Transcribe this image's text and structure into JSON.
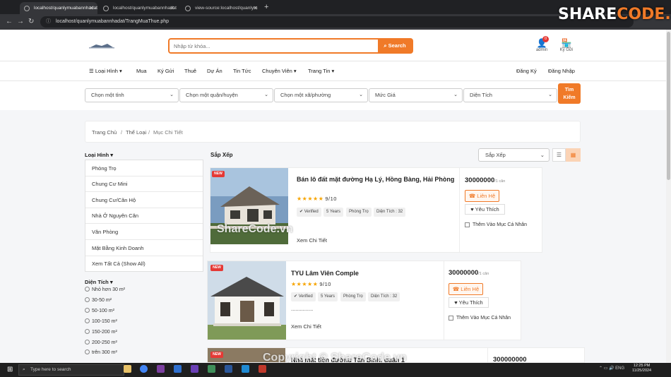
{
  "browser": {
    "tabs": [
      {
        "title": "localhost/quanlymuabannhadat"
      },
      {
        "title": "localhost/quanlymuabannhadat"
      },
      {
        "title": "view-source:localhost/quanlym"
      }
    ],
    "url": "localhost/quanlymuabannhadat/TrangMuaThue.php"
  },
  "brand_logo": {
    "part1": "SHARE",
    "part2": "CODE.vn"
  },
  "header": {
    "search_placeholder": "Nhập từ khóa...",
    "search_button": "Search",
    "user_label": "admin",
    "user_badge": "0",
    "deposit_label": "Ký Gửi"
  },
  "nav": {
    "items": [
      "Loại Hình",
      "Mua",
      "Ký Gửi",
      "Thuê",
      "Dự Án",
      "Tin Tức",
      "Chuyên Viên",
      "Trang Tin"
    ],
    "register": "Đăng Ký",
    "login": "Đăng Nhập"
  },
  "filter": {
    "province": "Chọn một tỉnh",
    "district": "Chọn một quận/huyện",
    "ward": "Chọn một xã/phường",
    "price": "Mức Giá",
    "area": "Diện Tích",
    "find_line1": "Tìm",
    "find_line2": "Kiếm"
  },
  "breadcrumb": [
    "Trang Chủ",
    "Thể Loại",
    "Mục Chi Tiết"
  ],
  "sidebar": {
    "type_heading": "Loại Hình",
    "categories": [
      "Phòng Trọ",
      "Chung Cư Mini",
      "Chung Cư/Căn Hộ",
      "Nhà Ở Nguyên Căn",
      "Văn Phòng",
      "Mặt Bằng Kinh Doanh",
      "Xem Tất Cả (Show All)"
    ],
    "area_heading": "Diện Tích",
    "areas": [
      "Nhỏ hơn 30 m²",
      "30-50 m²",
      "50-100 m²",
      "100-150 m²",
      "150-200 m²",
      "200-250 m²",
      "trên 300 m²"
    ]
  },
  "sort": {
    "label": "Sắp Xếp",
    "select": "Sắp Xếp"
  },
  "listings": [
    {
      "badge": "NEW",
      "title": "Bán lô đất mặt đường Hạ Lý, Hồng Bàng, Hải Phòng",
      "rating": "9/10",
      "tags": [
        "✔ Verified",
        "5 Years",
        "Phòng Trọ",
        "Diện Tích : 32"
      ],
      "dots": "...............",
      "detail": "Xem Chi Tiết",
      "price": "30000000",
      "unit": "/1 căn",
      "contact": "Liên Hệ",
      "like": "Yêu Thích",
      "save": "Thêm Vào Mục Cá Nhân"
    },
    {
      "badge": "NEW",
      "title": "TYU Lâm Viên Comple",
      "rating": "9/10",
      "tags": [
        "✔ Verified",
        "5 Years",
        "Phòng Trọ",
        "Diện Tích : 32"
      ],
      "dots": "...............",
      "detail": "Xem Chi Tiết",
      "price": "30000000",
      "unit": "/1 căn",
      "contact": "Liên Hệ",
      "like": "Yêu Thích",
      "save": "Thêm Vào Mục Cá Nhân"
    },
    {
      "badge": "NEW",
      "title": "Nhà mặt tiền đường Tân Bình, quận 1",
      "price": "300000000"
    }
  ],
  "watermark": "Copyright © ShareCode.vn",
  "image_watermark": "ShareCode.vn",
  "taskbar": {
    "search": "Type here to search",
    "tray": "ENG",
    "time": "12:25 PM",
    "date": "11/25/2024"
  }
}
